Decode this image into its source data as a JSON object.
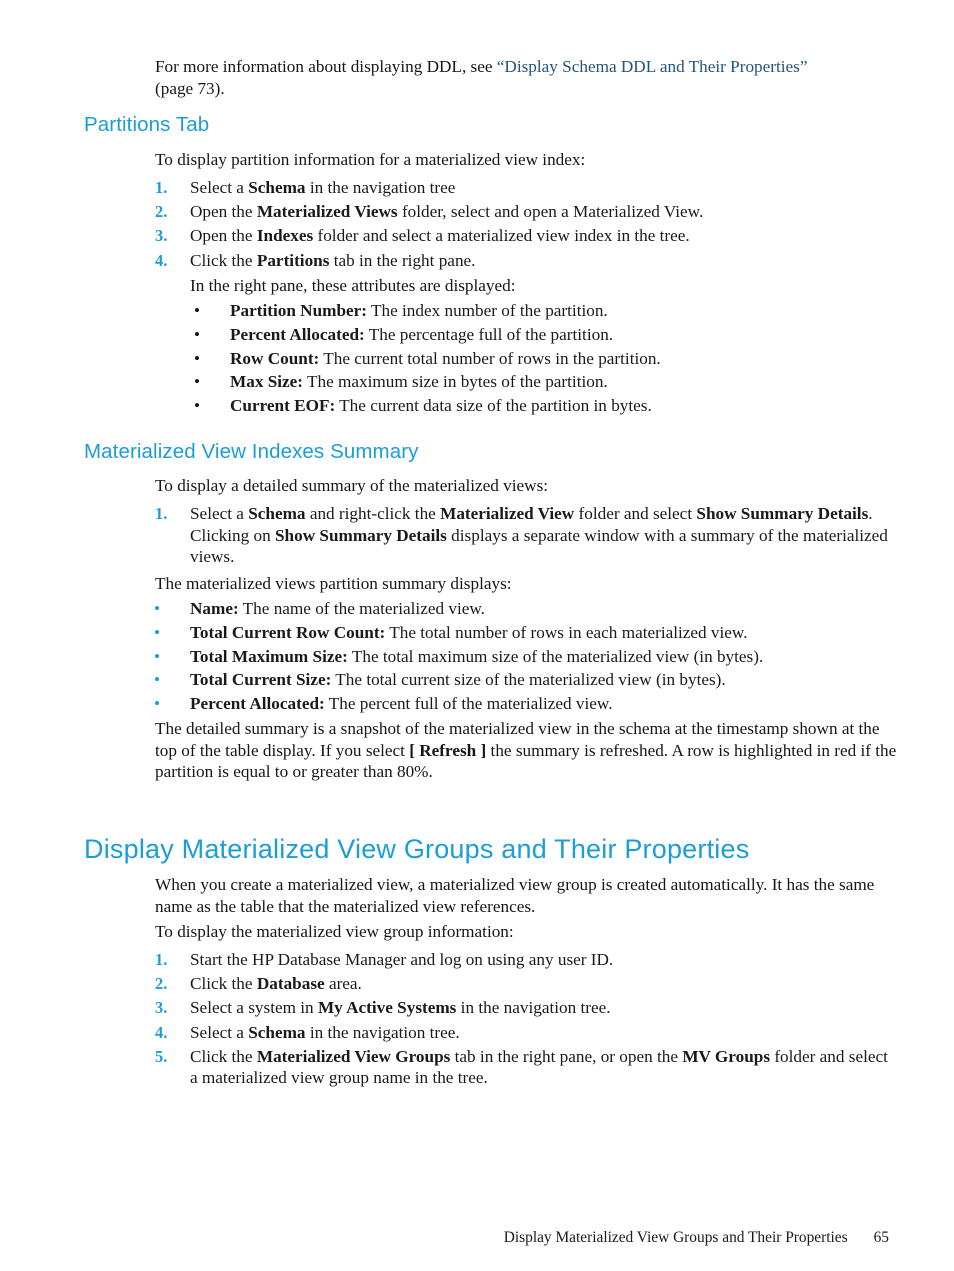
{
  "colors": {
    "heading_blue": "#1b9dd9",
    "xref_blue": "#23537f",
    "body_black": "#161616",
    "page_background": "#ffffff"
  },
  "intro": {
    "line_a": "For more information about displaying DDL, see ",
    "xref": "“Display Schema DDL and Their Properties”",
    "line_b": "(page 73)."
  },
  "sections": {
    "partitions_tab": {
      "heading": "Partitions Tab",
      "lead_in": "To display partition information for a materialized view index:",
      "steps": [
        {
          "num": "1.",
          "pre": "Select a ",
          "bold": "Schema",
          "post": " in the navigation tree"
        },
        {
          "num": "2.",
          "pre": "Open the ",
          "bold": "Materialized Views",
          "post": " folder, select and open a Materialized View."
        },
        {
          "num": "3.",
          "pre": "Open the ",
          "bold": "Indexes",
          "post": " folder and select a materialized view index in the tree."
        },
        {
          "num": "4.",
          "pre": "Click the ",
          "bold": "Partitions",
          "post": " tab in the right pane."
        }
      ],
      "attributes_lead_in": "In the right pane, these attributes are displayed:",
      "attributes": [
        {
          "term": "Partition Number:",
          "desc": " The index number of the partition."
        },
        {
          "term": "Percent Allocated:",
          "desc": " The percentage full of the partition."
        },
        {
          "term": "Row Count:",
          "desc": " The current total number of rows in the partition."
        },
        {
          "term": "Max Size:",
          "desc": " The maximum size in bytes of the partition."
        },
        {
          "term": "Current EOF:",
          "desc": " The current data size of the partition in bytes."
        }
      ]
    },
    "mv_indexes_summary": {
      "heading": "Materialized View Indexes Summary",
      "lead_in": "To display a detailed summary of the materialized views:",
      "step1": {
        "num": "1.",
        "p1": "Select a ",
        "b1": "Schema",
        "p2": " and right-click the ",
        "b2": "Materialized View",
        "p3": " folder and select ",
        "b3": "Show Summary Details",
        "p4": ". Clicking on ",
        "b4": "Show Summary Details",
        "p5": " displays a separate window with a summary of the materialized views."
      },
      "summary_lead_in": "The materialized views partition summary displays:",
      "summary_items": [
        {
          "term": "Name:",
          "desc": " The name of the materialized view."
        },
        {
          "term": "Total Current Row Count:",
          "desc": " The total number of rows in each materialized view."
        },
        {
          "term": "Total Maximum Size:",
          "desc": " The total maximum size of the materialized view (in bytes)."
        },
        {
          "term": "Total Current Size:",
          "desc": " The total current size of the materialized view (in bytes)."
        },
        {
          "term": "Percent Allocated:",
          "desc": " The percent full of the materialized view."
        }
      ],
      "closing": {
        "p1": "The detailed summary is a snapshot of the materialized view in the schema at the timestamp shown at the top of the table display. If you select ",
        "b1": "[ Refresh ]",
        "p2": " the summary is refreshed. A row is highlighted in red if the partition is equal to or greater than 80%."
      }
    },
    "mv_groups": {
      "heading": "Display Materialized View Groups and Their Properties",
      "para1": "When you create a materialized view, a materialized view group is created automatically. It has the same name as the table that the materialized view references.",
      "lead_in": "To display the materialized view group information:",
      "steps": [
        {
          "num": "1.",
          "pre": "Start the HP Database Manager and log on using any user ID.",
          "bold": "",
          "post": ""
        },
        {
          "num": "2.",
          "pre": "Click the ",
          "bold": "Database",
          "post": " area."
        },
        {
          "num": "3.",
          "pre": "Select a system in ",
          "bold": "My Active Systems",
          "post": " in the navigation tree."
        },
        {
          "num": "4.",
          "pre": "Select a ",
          "bold": "Schema",
          "post": " in the navigation tree."
        }
      ],
      "step5": {
        "num": "5.",
        "p1": "Click the ",
        "b1": "Materialized View Groups",
        "p2": " tab in the right pane, or open the ",
        "b2": "MV Groups",
        "p3": " folder and select a materialized view group name in the tree."
      }
    }
  },
  "footer": {
    "title": "Display Materialized View Groups and Their Properties",
    "page_number": "65"
  }
}
